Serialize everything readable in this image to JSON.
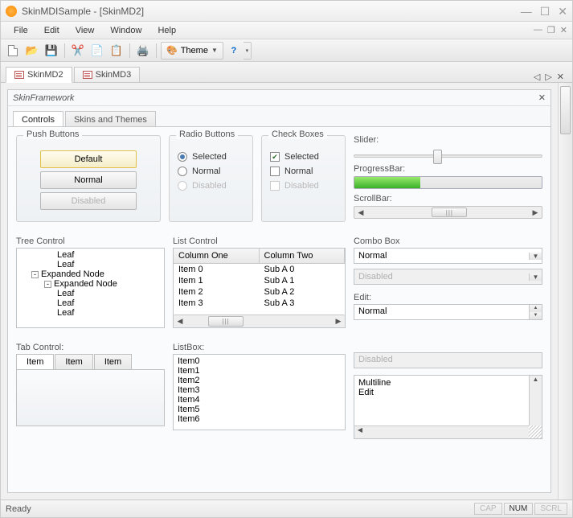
{
  "title": "SkinMDISample - [SkinMD2]",
  "menu": [
    "File",
    "Edit",
    "View",
    "Window",
    "Help"
  ],
  "toolbar": {
    "theme": "Theme"
  },
  "mdi_tabs": [
    "SkinMD2",
    "SkinMD3"
  ],
  "panel_title": "SkinFramework",
  "ptabs": [
    "Controls",
    "Skins and Themes"
  ],
  "groups": {
    "push": {
      "title": "Push Buttons",
      "default": "Default",
      "normal": "Normal",
      "disabled": "Disabled"
    },
    "radio": {
      "title": "Radio Buttons",
      "selected": "Selected",
      "normal": "Normal",
      "disabled": "Disabled"
    },
    "check": {
      "title": "Check Boxes",
      "selected": "Selected",
      "normal": "Normal",
      "disabled": "Disabled"
    }
  },
  "slider": {
    "label": "Slider:",
    "pos": 42
  },
  "progress": {
    "label": "ProgressBar:",
    "pct": 35
  },
  "scrollbar": {
    "label": "ScrollBar:"
  },
  "tree": {
    "label": "Tree Control",
    "nodes": [
      {
        "indent": 3,
        "label": "Leaf"
      },
      {
        "indent": 3,
        "label": "Leaf"
      },
      {
        "indent": 1,
        "exp": "-",
        "label": "Expanded Node"
      },
      {
        "indent": 2,
        "exp": "-",
        "label": "Expanded Node"
      },
      {
        "indent": 3,
        "label": "Leaf"
      },
      {
        "indent": 3,
        "label": "Leaf"
      },
      {
        "indent": 3,
        "label": "Leaf"
      }
    ]
  },
  "list": {
    "label": "List Control",
    "cols": [
      "Column One",
      "Column Two"
    ],
    "rows": [
      [
        "Item 0",
        "Sub A 0"
      ],
      [
        "Item 1",
        "Sub A 1"
      ],
      [
        "Item 2",
        "Sub A 2"
      ],
      [
        "Item 3",
        "Sub A 3"
      ]
    ]
  },
  "combo": {
    "label": "Combo Box",
    "value": "Normal",
    "disabled": "Disabled"
  },
  "edit": {
    "label": "Edit:",
    "value": "Normal",
    "disabled": "Disabled"
  },
  "multi": {
    "l1": "Multiline",
    "l2": "Edit"
  },
  "tabctrl": {
    "label": "Tab Control:",
    "tabs": [
      "Item",
      "Item",
      "Item"
    ]
  },
  "listbox": {
    "label": "ListBox:",
    "items": [
      "Item0",
      "Item1",
      "Item2",
      "Item3",
      "Item4",
      "Item5",
      "Item6"
    ]
  },
  "status": {
    "ready": "Ready",
    "cap": "CAP",
    "num": "NUM",
    "scrl": "SCRL"
  }
}
